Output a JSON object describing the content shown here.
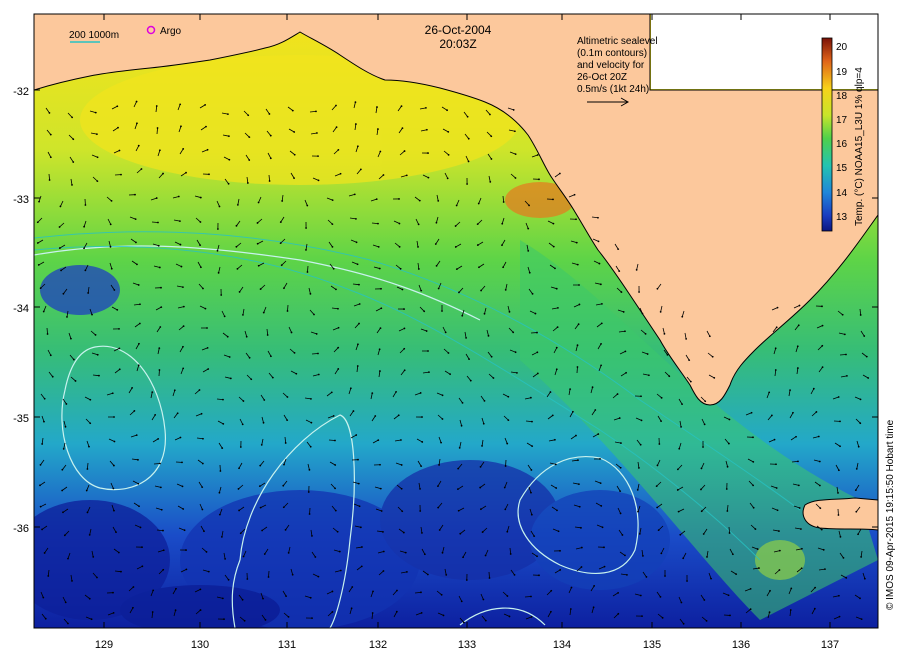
{
  "map": {
    "date": "26-Oct-2004",
    "time": "20:03Z",
    "legend_isobath": "200  1000m",
    "legend_argo": "Argo",
    "note_lines": [
      "Altimetric sealevel",
      "(0.1m contours)",
      "and velocity for",
      "26-Oct 20Z",
      "0.5m/s (1kt 24h)"
    ],
    "colorbar_title": "Temp. (°C) NOAA15_L3U 1% qlp=4",
    "colorbar_ticks": [
      "20",
      "19",
      "18",
      "17",
      "16",
      "15",
      "14",
      "13"
    ],
    "credit": "© IMOS 09-Apr-2015 19:15:50 Hobart time",
    "lon_ticks": [
      "129",
      "130",
      "131",
      "132",
      "133",
      "134",
      "135",
      "136",
      "137"
    ],
    "lat_ticks": [
      "-32",
      "-33",
      "-34",
      "-35",
      "-36"
    ],
    "colors": {
      "land": "#fcc89c",
      "contour": "#c8f2ee",
      "arrow": "#000000",
      "argo_marker": "#dd00dd",
      "isobath_200": "#27c3c3"
    }
  }
}
